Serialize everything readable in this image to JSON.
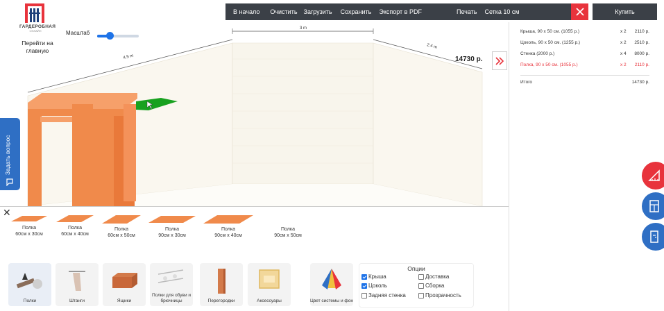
{
  "brand": {
    "name": "ГАРДЕРОБНАЯ",
    "sub": "ОНЛАЙН"
  },
  "home_link": "Перейти на главную",
  "scale": {
    "label": "Масштаб",
    "value": 0.3
  },
  "toolbar": {
    "start": "В начало",
    "clear": "Очистить",
    "load": "Загрузить",
    "save": "Сохранить",
    "export": "Экспорт в PDF",
    "print": "Печать",
    "grid": "Сетка 10 см",
    "buy": "Купить"
  },
  "total_price": "14730 р.",
  "order": {
    "items": [
      {
        "name": "Крыша, 90 х 50 см. (1055 р.)",
        "qty": "х 2",
        "price": "2110 р."
      },
      {
        "name": "Цоколь, 90 х 50 см. (1255 р.)",
        "qty": "х 2",
        "price": "2510 р."
      },
      {
        "name": "Стенка  (2000 р.)",
        "qty": "х 4",
        "price": "8000 р."
      },
      {
        "name": "Полка, 90 х 50 см. (1055 р.)",
        "qty": "х 2",
        "price": "2110 р.",
        "highlight": true
      }
    ],
    "total_label": "Итого",
    "total_value": "14730 р."
  },
  "ask_question": "Задать вопрос",
  "dimensions": {
    "left": "4.5 m",
    "back": "3 m",
    "right": "2.4 m"
  },
  "shelves": [
    {
      "title": "Полка",
      "size": "60см х 30см"
    },
    {
      "title": "Полка",
      "size": "60см х 40см"
    },
    {
      "title": "Полка",
      "size": "60см х 50см"
    },
    {
      "title": "Полка",
      "size": "90см х 30см"
    },
    {
      "title": "Полка",
      "size": "90см х 40см"
    },
    {
      "title": "Полка",
      "size": "90см х 50см"
    }
  ],
  "categories": [
    {
      "label": "Полки"
    },
    {
      "label": "Штанги"
    },
    {
      "label": "Ящики"
    },
    {
      "label": "Полки для обуви и брючницы"
    },
    {
      "label": "Перегородки"
    },
    {
      "label": "Аксессуары"
    },
    {
      "label": "Цвет системы и фон"
    }
  ],
  "options": {
    "title": "Опции",
    "items": [
      {
        "label": "Крыша",
        "checked": true
      },
      {
        "label": "Доставка",
        "checked": false
      },
      {
        "label": "Цоколь",
        "checked": true
      },
      {
        "label": "Сборка",
        "checked": false
      },
      {
        "label": "Задняя стенка",
        "checked": false
      },
      {
        "label": "Прозрачность",
        "checked": false
      }
    ]
  },
  "colors": {
    "accent": "#1e73e8",
    "danger": "#e8333c",
    "toolbar": "#3b4047",
    "wardrobe": "#f08a4b",
    "selected": "#18a11f"
  }
}
